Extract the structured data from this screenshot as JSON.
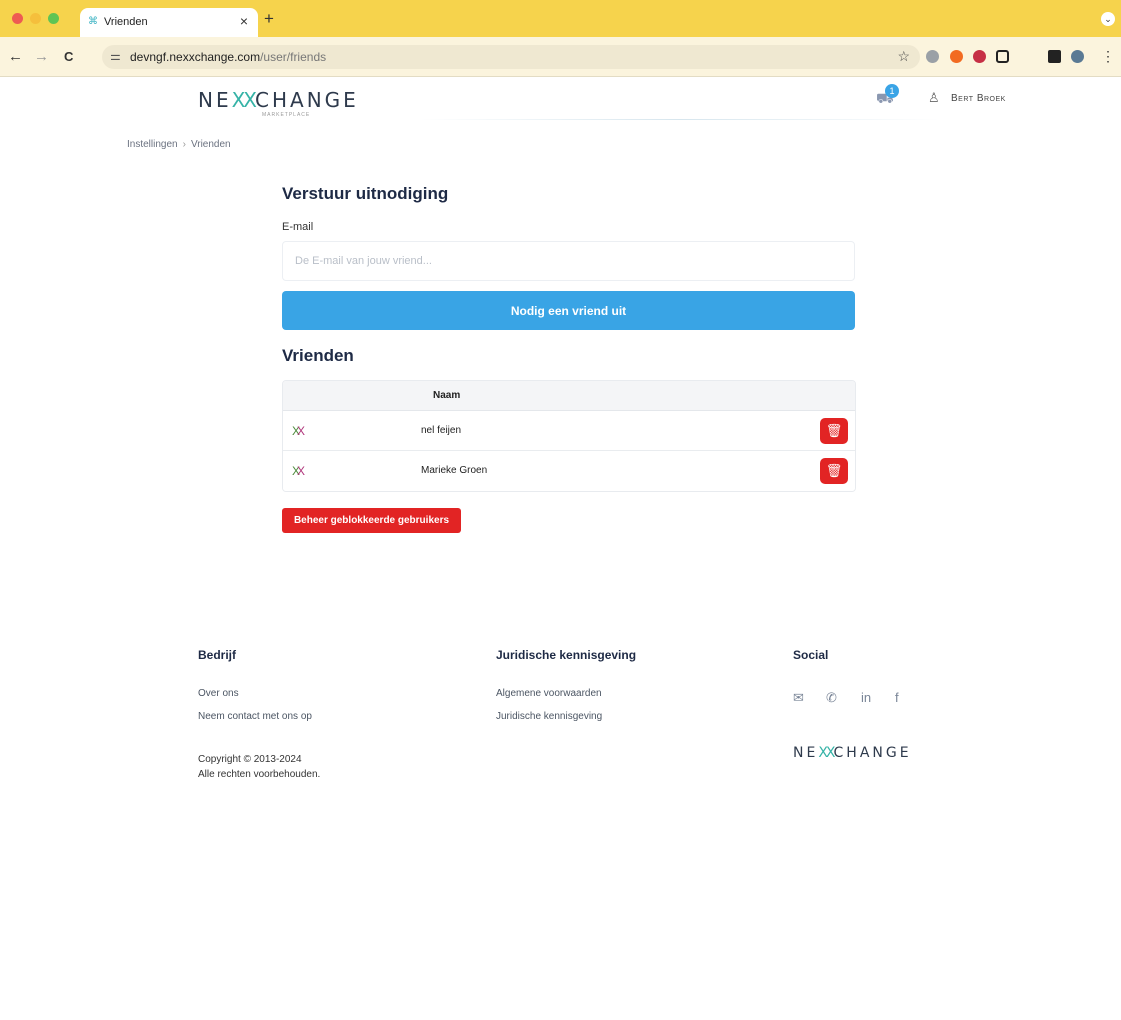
{
  "browser": {
    "tab_title": "Vrienden",
    "tab_close": "×",
    "new_tab": "+",
    "tab_menu": "⌄",
    "back": "←",
    "forward": "→",
    "reload": "C",
    "url_host": "devngf.nexxchange.com",
    "url_path": "/user/friends",
    "star": "☆"
  },
  "header": {
    "logo_left": "NE",
    "logo_mark": "XX",
    "logo_right": "CHANGE",
    "logo_sub": "MARKETPLACE",
    "cart_badge": "1",
    "user_name": "Bert Broek"
  },
  "breadcrumb": {
    "parent": "Instellingen",
    "separator": "›",
    "current": "Vrienden"
  },
  "invite": {
    "title": "Verstuur uitnodiging",
    "email_label": "E-mail",
    "email_placeholder": "De E-mail van jouw vriend...",
    "email_value": "",
    "button_label": "Nodig een vriend uit"
  },
  "friends": {
    "title": "Vrienden",
    "column_name": "Naam",
    "rows": [
      {
        "name": "nel feijen"
      },
      {
        "name": "Marieke Groen"
      }
    ],
    "delete_icon": "trash-icon",
    "blocked_button": "Beheer geblokkeerde gebruikers"
  },
  "footer": {
    "company_heading": "Bedrijf",
    "company_links": [
      "Over ons",
      "Neem contact met ons op"
    ],
    "legal_heading": "Juridische kennisgeving",
    "legal_links": [
      "Algemene voorwaarden",
      "Juridische kennisgeving"
    ],
    "social_heading": "Social",
    "social_icons": [
      "mail-icon",
      "phone-icon",
      "linkedin-icon",
      "facebook-icon"
    ],
    "social_linkedin": "in",
    "social_facebook": "f",
    "copyright_line1": "Copyright © 2013-2024",
    "copyright_line2": "Alle rechten voorbehouden.",
    "logo_left": "NE",
    "logo_mark": "XX",
    "logo_right": "CHANGE"
  },
  "colors": {
    "browser_frame": "#f6d34c",
    "primary_button": "#39a4e5",
    "danger": "#e22424",
    "heading": "#1e2a45",
    "brand_teal": "#36b3a7"
  }
}
